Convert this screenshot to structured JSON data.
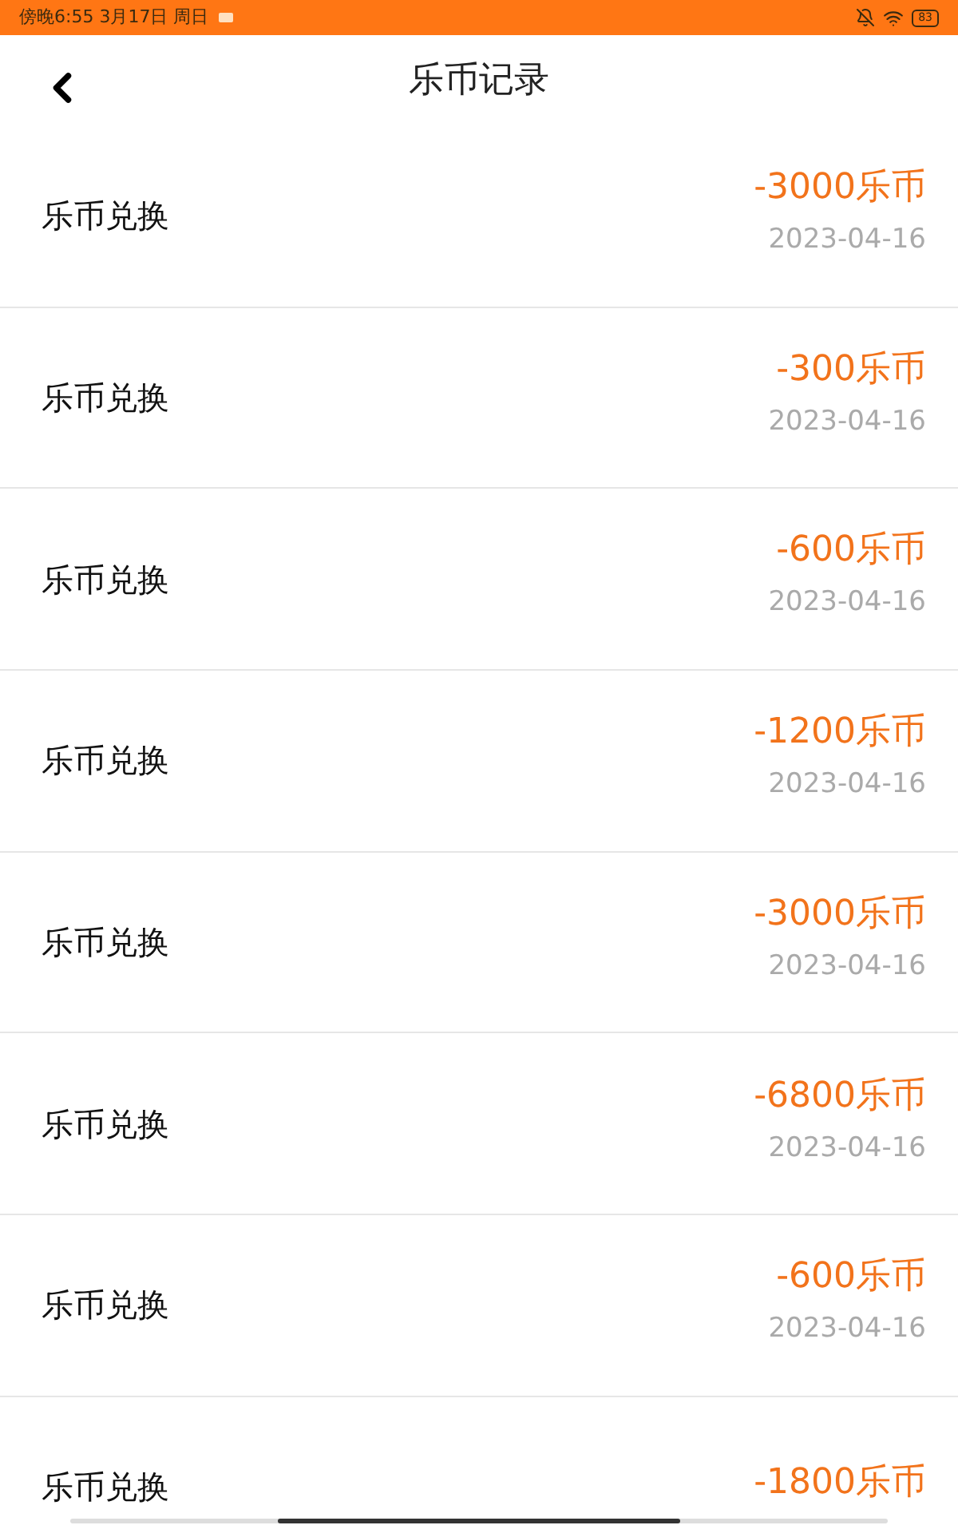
{
  "status_bar": {
    "time": "傍晚6:55 3月17日 周日",
    "battery": "83"
  },
  "header": {
    "title": "乐币记录"
  },
  "records": [
    {
      "label": "乐币兑换",
      "amount": "-3000乐币",
      "date": "2023-04-16"
    },
    {
      "label": "乐币兑换",
      "amount": "-300乐币",
      "date": "2023-04-16"
    },
    {
      "label": "乐币兑换",
      "amount": "-600乐币",
      "date": "2023-04-16"
    },
    {
      "label": "乐币兑换",
      "amount": "-1200乐币",
      "date": "2023-04-16"
    },
    {
      "label": "乐币兑换",
      "amount": "-3000乐币",
      "date": "2023-04-16"
    },
    {
      "label": "乐币兑换",
      "amount": "-6800乐币",
      "date": "2023-04-16"
    },
    {
      "label": "乐币兑换",
      "amount": "-600乐币",
      "date": "2023-04-16"
    },
    {
      "label": "乐币兑换",
      "amount": "-1800乐币"
    }
  ]
}
